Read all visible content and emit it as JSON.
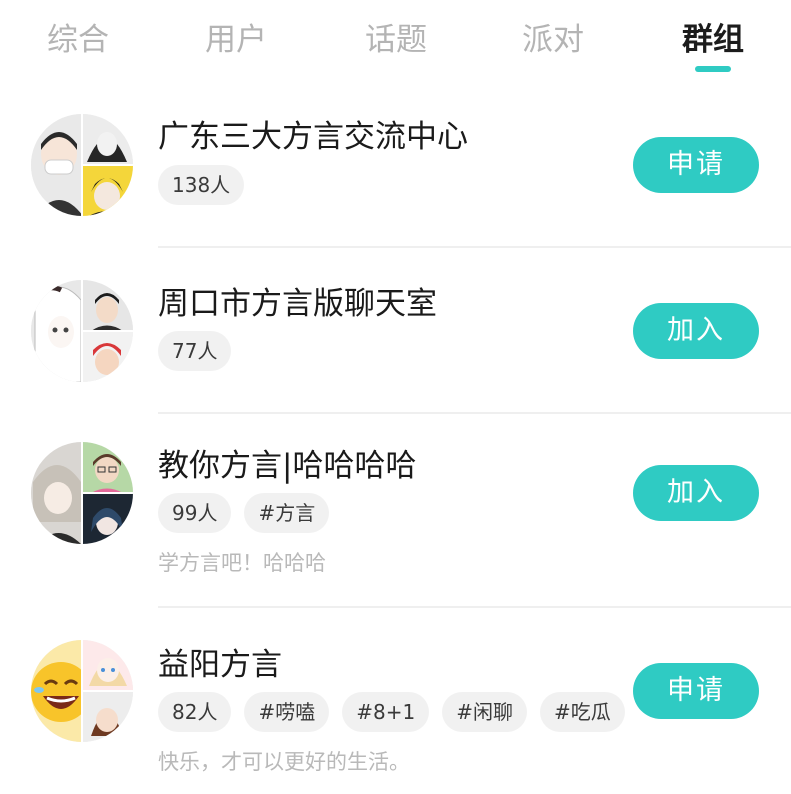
{
  "tabs": [
    {
      "label": "综合",
      "active": false
    },
    {
      "label": "用户",
      "active": false
    },
    {
      "label": "话题",
      "active": false
    },
    {
      "label": "派对",
      "active": false
    },
    {
      "label": "群组",
      "active": true
    }
  ],
  "accent_color": "#2fcbc3",
  "groups": [
    {
      "name": "广东三大方言交流中心",
      "members": "138人",
      "tags": [],
      "description": "",
      "button_label": "申请",
      "avatar_icons": [
        "mask-person-icon",
        "hooded-anime-icon",
        "anime-boy-yellow-icon"
      ]
    },
    {
      "name": "周口市方言版聊天室",
      "members": "77人",
      "tags": [],
      "description": "",
      "button_label": "加入",
      "avatar_icons": [
        "anime-girl-icon",
        "black-hair-boy-icon",
        "red-hair-boy-icon"
      ]
    },
    {
      "name": "教你方言|哈哈哈哈",
      "members": "99人",
      "tags": [
        "#方言"
      ],
      "description": "学方言吧！哈哈哈",
      "button_label": "加入",
      "avatar_icons": [
        "silver-hair-anime-icon",
        "glasses-person-icon",
        "blue-hair-anime-icon"
      ]
    },
    {
      "name": "益阳方言",
      "members": "82人",
      "tags": [
        "#唠嗑",
        "#8+1",
        "#闲聊",
        "#吃瓜"
      ],
      "description": "快乐，才可以更好的生活。",
      "button_label": "申请",
      "avatar_icons": [
        "laughing-emoji-icon",
        "blonde-anime-girl-icon",
        "brown-hair-girl-icon"
      ]
    }
  ]
}
